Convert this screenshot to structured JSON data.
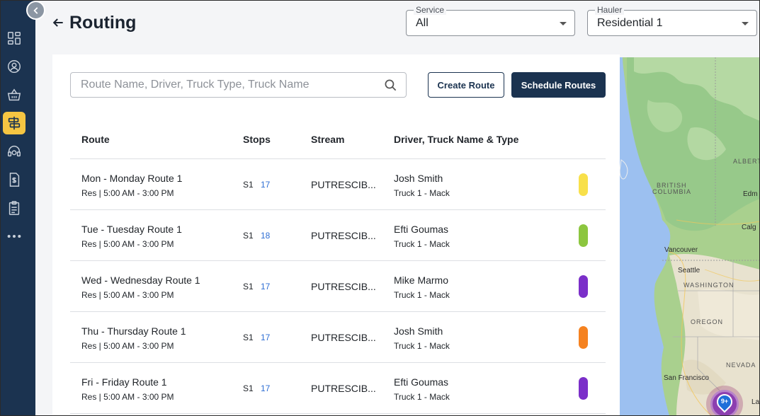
{
  "header": {
    "title": "Routing",
    "service": {
      "label": "Service",
      "value": "All"
    },
    "hauler": {
      "label": "Hauler",
      "value": "Residential 1"
    }
  },
  "search": {
    "placeholder": "Route Name, Driver, Truck Type, Truck Name"
  },
  "buttons": {
    "create": "Create Route",
    "schedule": "Schedule Routes"
  },
  "table": {
    "headers": {
      "route": "Route",
      "stops": "Stops",
      "stream": "Stream",
      "driver": "Driver, Truck Name & Type"
    },
    "rows": [
      {
        "name": "Mon - Monday Route 1",
        "time": "Res | 5:00 AM - 3:00 PM",
        "stop_code": "S1",
        "stops": "17",
        "stream": "PUTRESCIB...",
        "driver": "Josh Smith",
        "truck": "Truck 1 - Mack",
        "color": "#f8e04a"
      },
      {
        "name": "Tue - Tuesday Route 1",
        "time": "Res | 5:00 AM - 3:00 PM",
        "stop_code": "S1",
        "stops": "18",
        "stream": "PUTRESCIB...",
        "driver": "Efti Goumas",
        "truck": "Truck 1 - Mack",
        "color": "#8cc63f"
      },
      {
        "name": "Wed - Wednesday Route 1",
        "time": "Res | 5:00 AM - 3:00 PM",
        "stop_code": "S1",
        "stops": "17",
        "stream": "PUTRESCIB...",
        "driver": "Mike Marmo",
        "truck": "Truck 1 - Mack",
        "color": "#7b2fc9"
      },
      {
        "name": "Thu - Thursday Route 1",
        "time": "Res | 5:00 AM - 3:00 PM",
        "stop_code": "S1",
        "stops": "17",
        "stream": "PUTRESCIB...",
        "driver": "Josh Smith",
        "truck": "Truck 1 - Mack",
        "color": "#f58220"
      },
      {
        "name": "Fri - Friday Route 1",
        "time": "Res | 5:00 AM - 3:00 PM",
        "stop_code": "S1",
        "stops": "17",
        "stream": "PUTRESCIB...",
        "driver": "Efti Goumas",
        "truck": "Truck 1 - Mack",
        "color": "#7b2fc9"
      }
    ]
  },
  "map": {
    "labels": {
      "alberta": "ALBERT",
      "bc1": "BRITISH",
      "bc2": "COLUMBIA",
      "edmonton": "Edm",
      "calgary": "Calg",
      "vancouver": "Vancouver",
      "seattle": "Seattle",
      "washington": "WASHINGTON",
      "oregon": "OREGON",
      "nevada": "NEVADA",
      "sf": "San Francisco",
      "la": "La"
    },
    "cluster": "9+"
  },
  "sidebar": {
    "icons": [
      "dashboard-icon",
      "customer-icon",
      "basket-icon",
      "routing-icon",
      "support-icon",
      "billing-icon",
      "checklist-icon",
      "more-icon"
    ]
  },
  "colors": {
    "sidebar": "#1b3350",
    "accent": "#f5c542",
    "primary": "#1b3350",
    "link": "#2f6fd4"
  }
}
